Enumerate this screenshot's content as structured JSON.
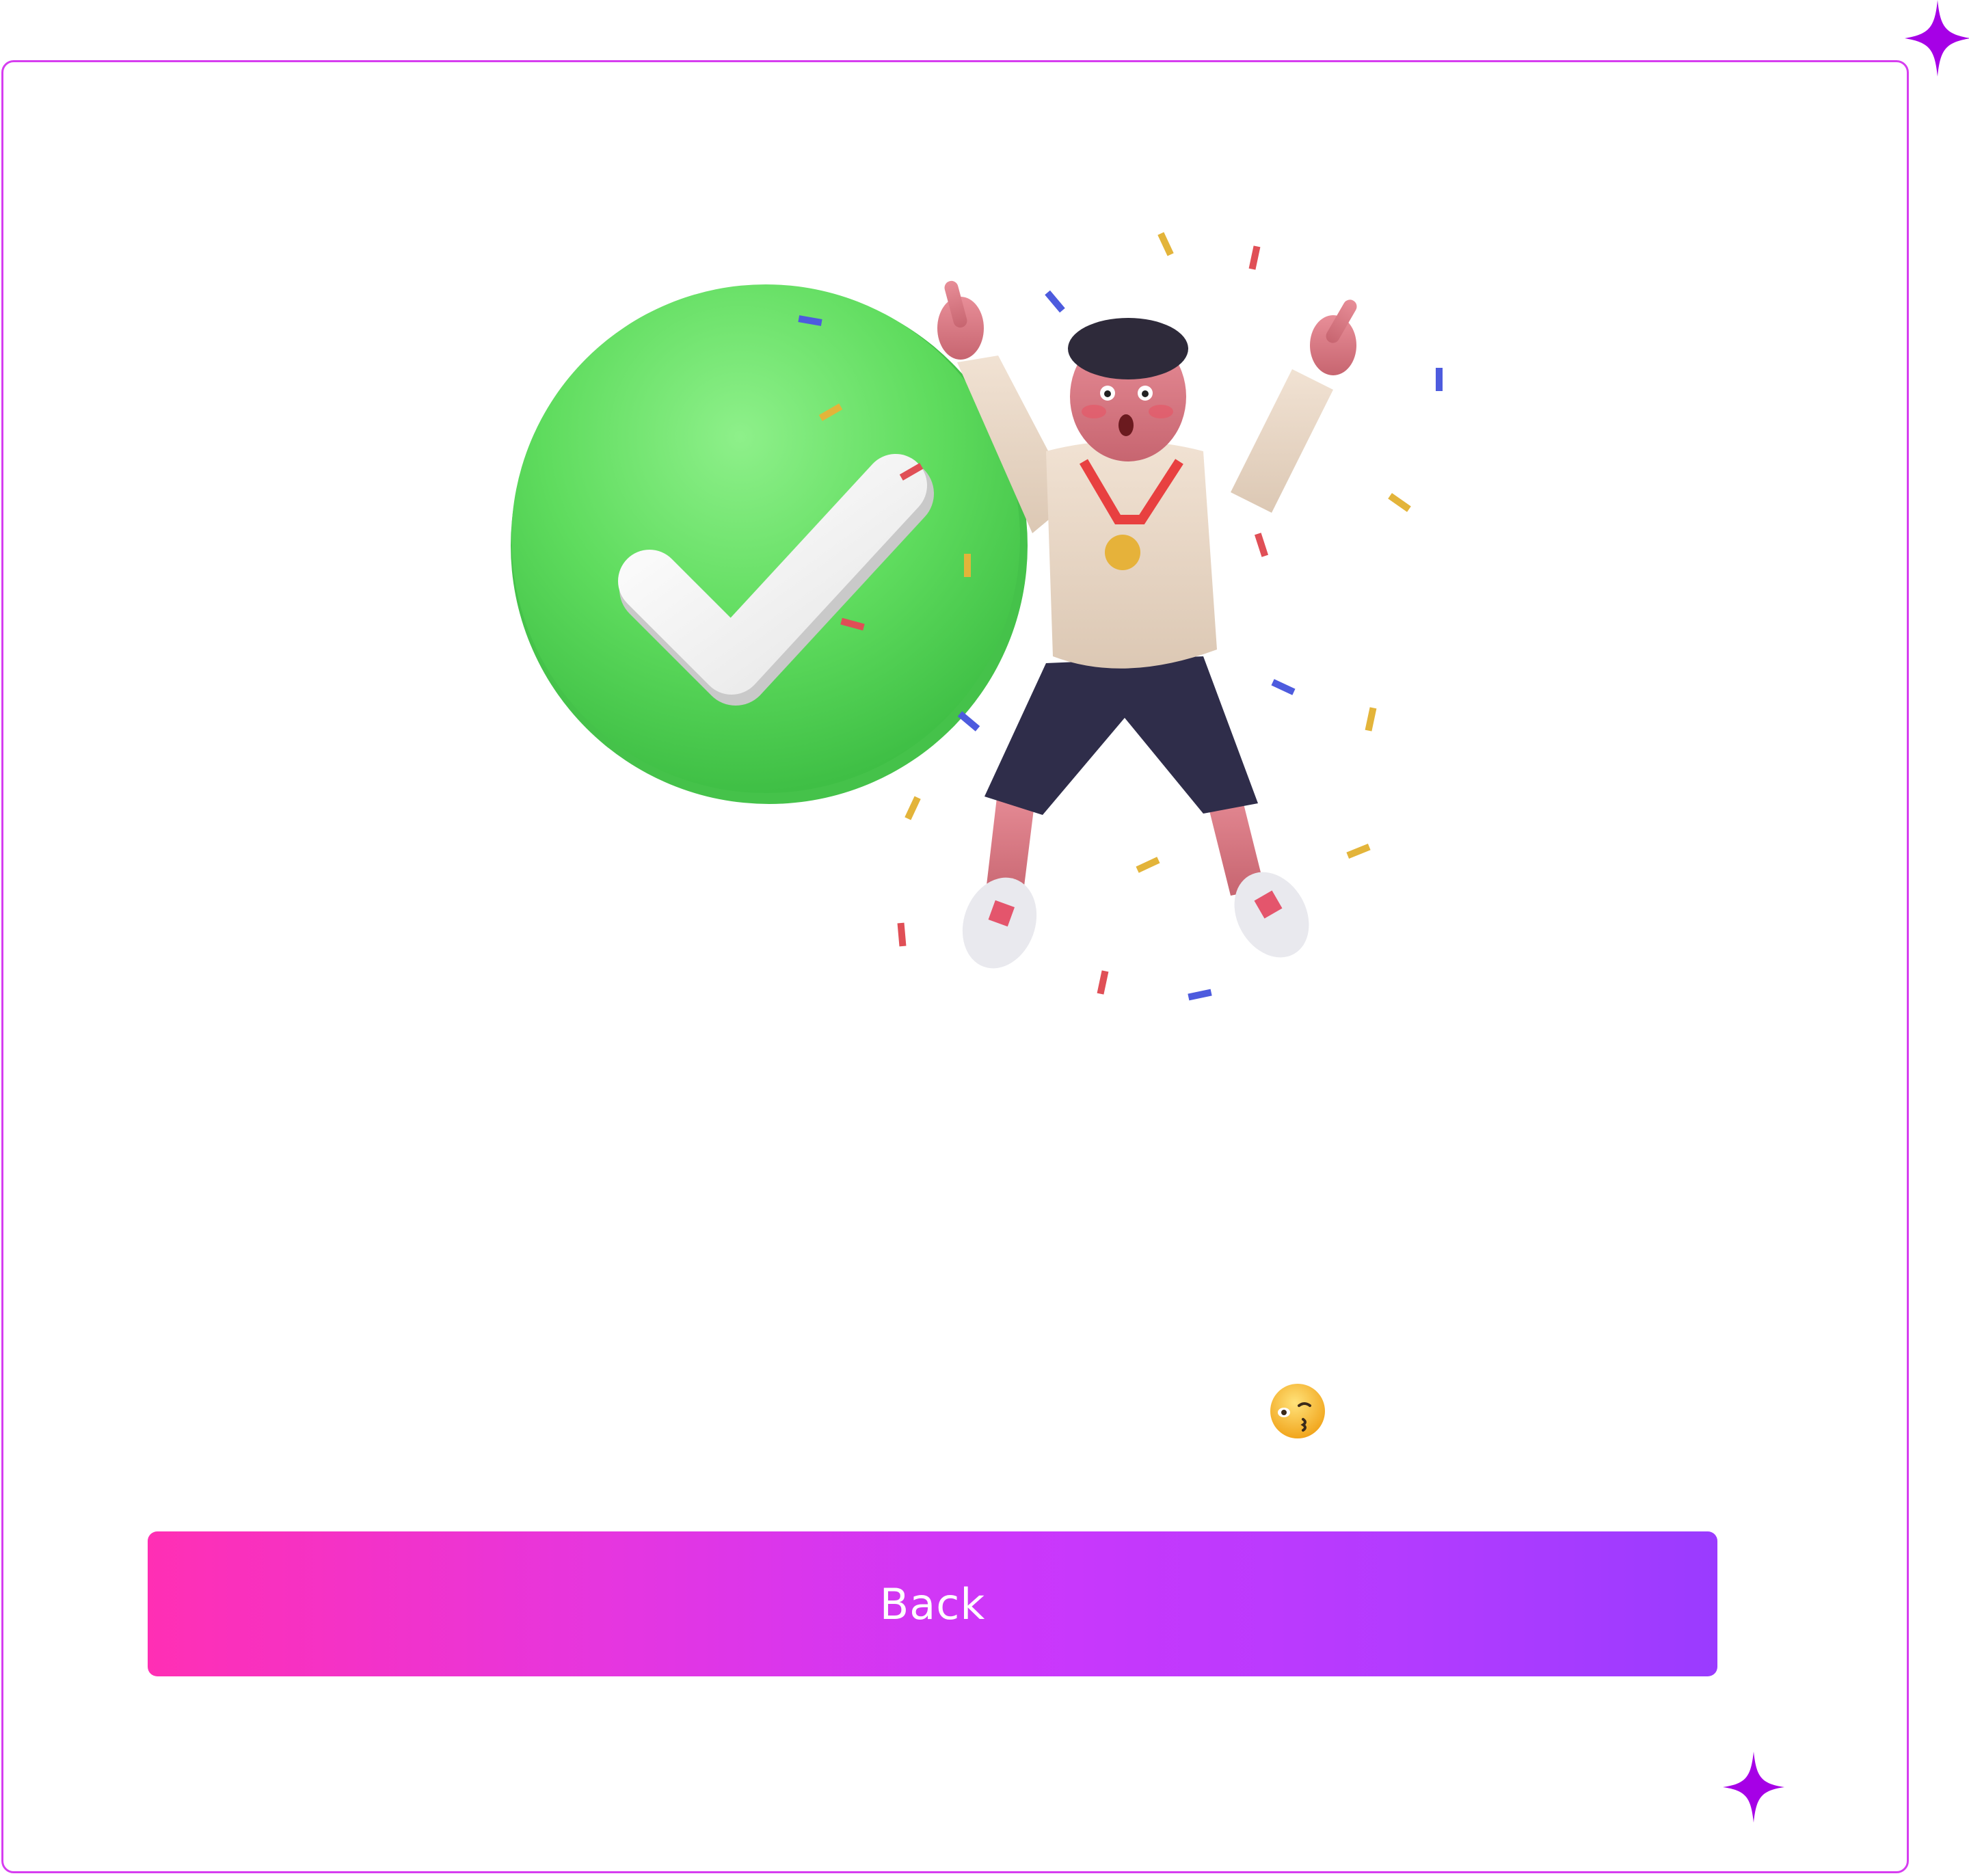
{
  "colors": {
    "frame_border": "#d63df0",
    "sparkle": "#a600e6",
    "check_green": "#5cd65c",
    "button_gradient_start": "#ff2fb4",
    "button_gradient_end": "#9a3bff"
  },
  "illustration": {
    "icons": [
      "check-circle-icon",
      "celebrating-person-illustration",
      "confetti-decoration"
    ]
  },
  "emoji": {
    "icon": "winking-kiss-emoji"
  },
  "actions": {
    "back_label": "Back"
  }
}
